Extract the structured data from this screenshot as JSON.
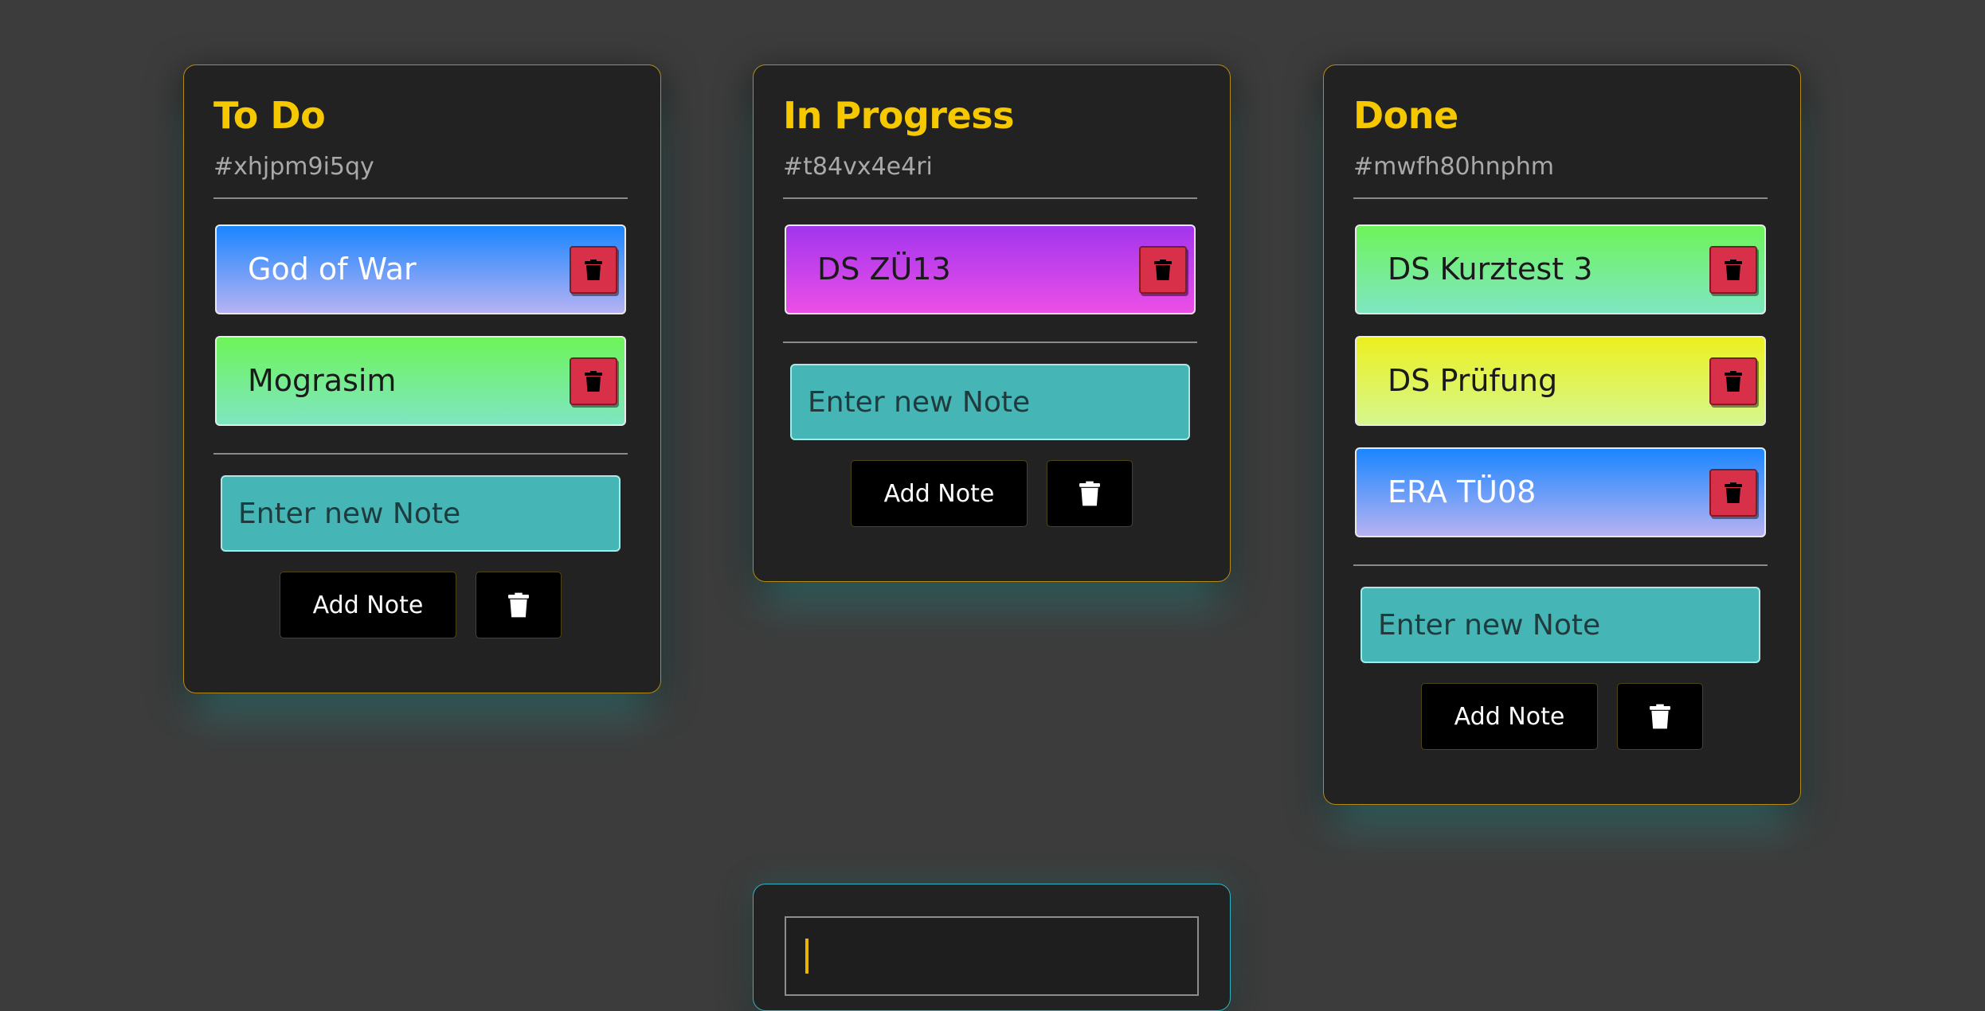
{
  "boards": [
    {
      "title": "To Do",
      "id": "#xhjpm9i5qy",
      "notes": [
        {
          "text": "God of War",
          "gradient": [
            "#1b86ff",
            "#b6b2f2"
          ],
          "text_color": "#ffffff"
        },
        {
          "text": "Mograsim",
          "gradient": [
            "#6ef45a",
            "#7fe6c2"
          ],
          "text_color": "#1a1a1a"
        }
      ],
      "input_placeholder": "Enter new Note",
      "add_label": "Add Note"
    },
    {
      "title": "In Progress",
      "id": "#t84vx4e4ri",
      "notes": [
        {
          "text": "DS ZÜ13",
          "gradient": [
            "#a235ee",
            "#ec4fe6"
          ],
          "text_color": "#1a1a1a"
        }
      ],
      "input_placeholder": "Enter new Note",
      "add_label": "Add Note"
    },
    {
      "title": "Done",
      "id": "#mwfh80hnphm",
      "notes": [
        {
          "text": "DS Kurztest 3",
          "gradient": [
            "#6ef45a",
            "#7fe6c2"
          ],
          "text_color": "#1a1a1a"
        },
        {
          "text": "DS Prüfung",
          "gradient": [
            "#ecf020",
            "#d6f78e"
          ],
          "text_color": "#1a1a1a"
        },
        {
          "text": "ERA TÜ08",
          "gradient": [
            "#1b86ff",
            "#b6b2f2"
          ],
          "text_color": "#ffffff"
        }
      ],
      "input_placeholder": "Enter new Note",
      "add_label": "Add Note"
    }
  ],
  "new_board": {
    "input_value": ""
  },
  "icons": {
    "note_delete": "trash-icon",
    "clear_board": "trash-icon"
  },
  "colors": {
    "background": "#3c3c3c",
    "board_bg": "#222222",
    "title": "#f5c800",
    "board_border": "#b58a12",
    "input_bg": "#45b5b5",
    "delete_red": "#d9304a"
  }
}
